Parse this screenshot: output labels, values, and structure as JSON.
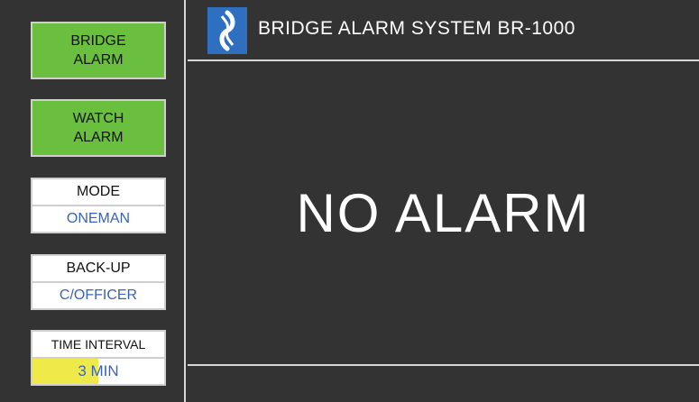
{
  "header": {
    "title": "BRIDGE ALARM SYSTEM BR-1000",
    "logo_icon": "propeller-logo-icon"
  },
  "left_panel": {
    "bridge_alarm_label": "BRIDGE\nALARM",
    "watch_alarm_label": "WATCH\nALARM",
    "mode": {
      "label": "MODE",
      "value": "ONEMAN"
    },
    "backup": {
      "label": "BACK-UP",
      "value": "C/OFFICER"
    },
    "time_interval": {
      "label": "TIME INTERVAL",
      "value": "3 MIN",
      "progress": 0.5
    }
  },
  "main": {
    "status": "NO ALARM"
  },
  "colors": {
    "background": "#333333",
    "alarm_button_green": "#6abf3f",
    "value_blue": "#3a63b8",
    "interval_fill_yellow": "#f0e94a",
    "logo_blue": "#2f6fc0"
  }
}
